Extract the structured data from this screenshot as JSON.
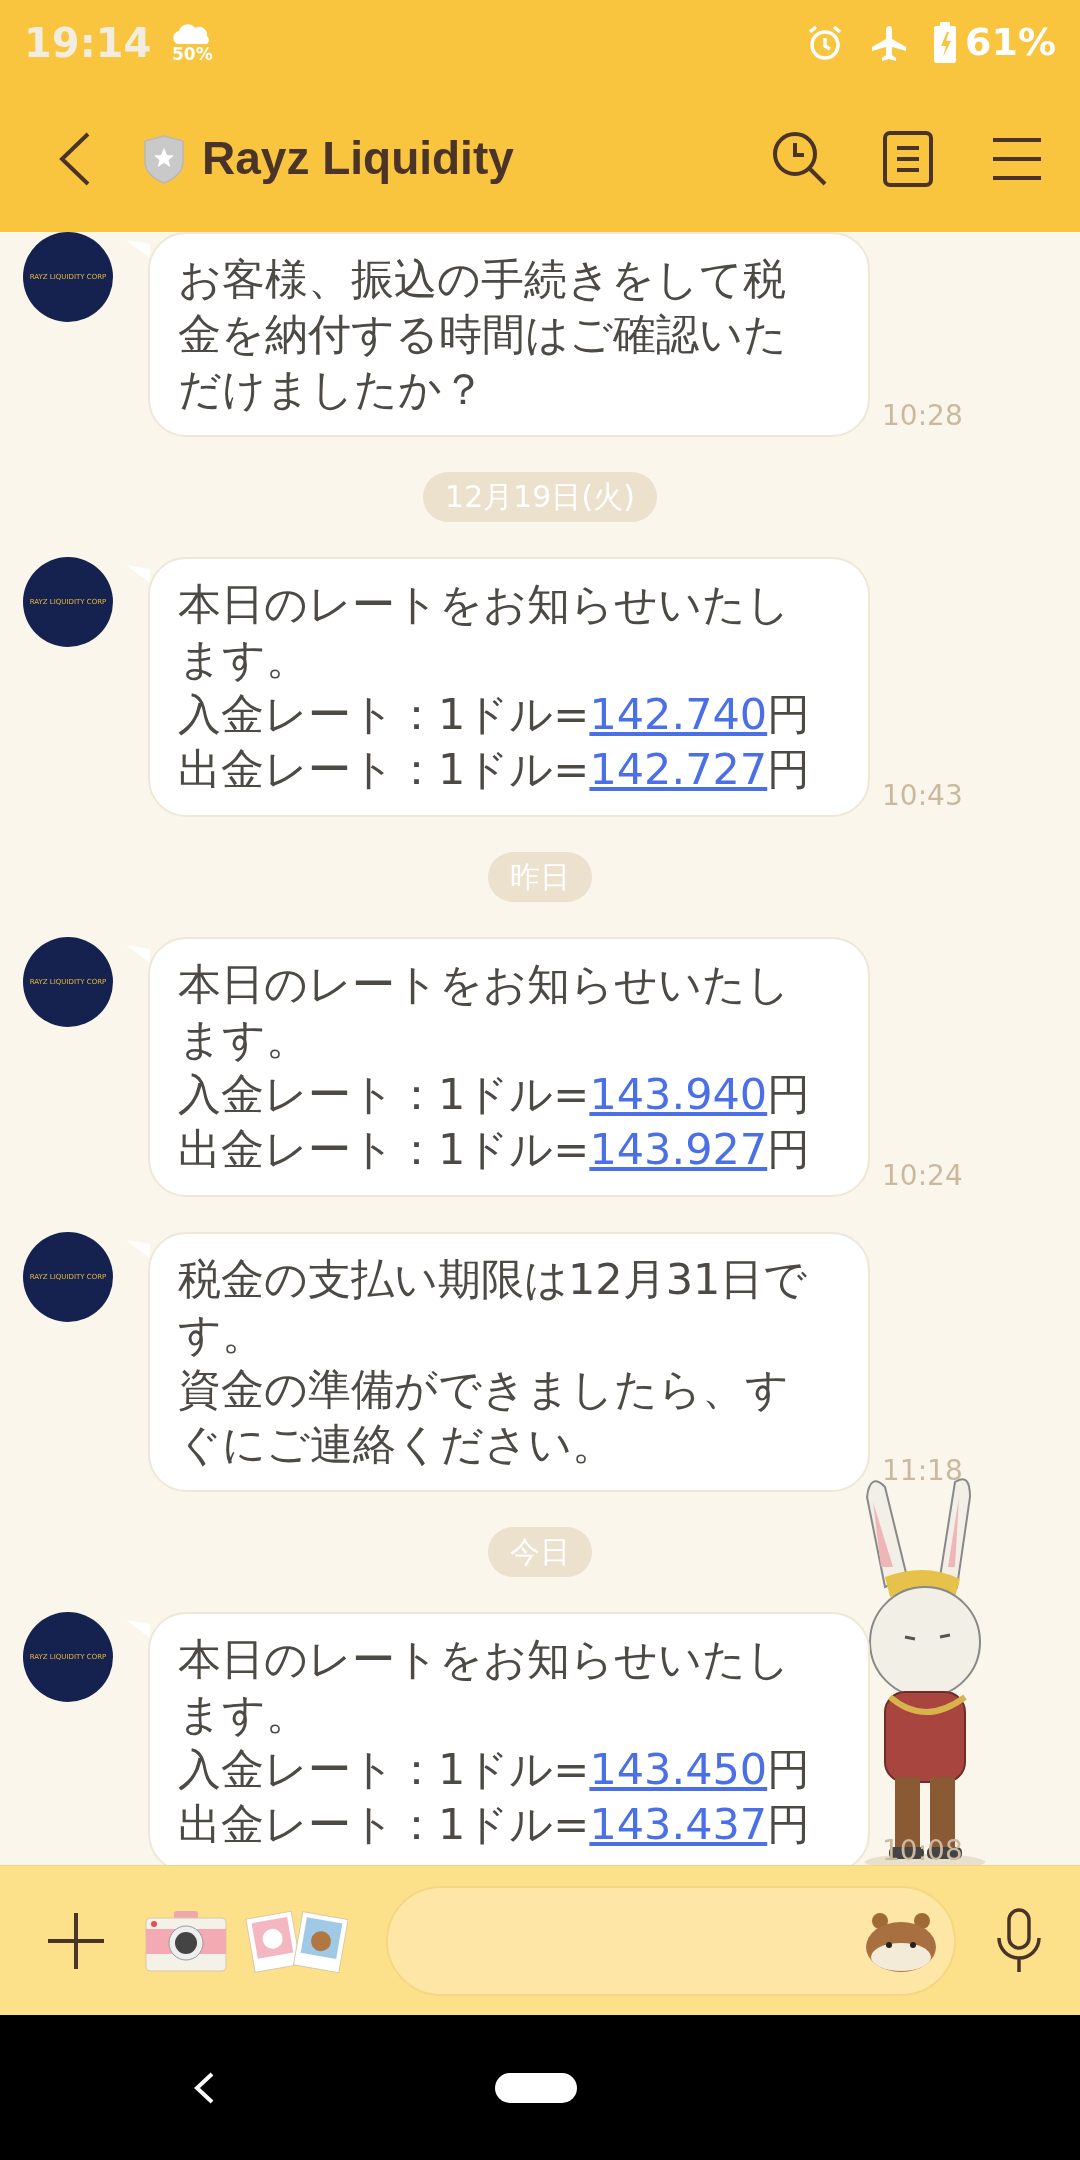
{
  "status_bar": {
    "time": "19:14",
    "weather": "50%",
    "battery": "61%"
  },
  "header": {
    "title": "Rayz Liquidity"
  },
  "chat": [
    {
      "kind": "message",
      "avatar_label": "RAYZ LIQUIDITY CORP",
      "text": "お客様、振込の手続きをして税金を納付する時間はご確認いただけましたか？",
      "time": "10:28"
    },
    {
      "kind": "date",
      "label": "12月19日(火)"
    },
    {
      "kind": "message",
      "avatar_label": "RAYZ LIQUIDITY CORP",
      "text": "本日のレートをお知らせいたします。",
      "rates": [
        {
          "label": "入金レート：1ドル=",
          "amount": "142.740",
          "unit": "円"
        },
        {
          "label": "出金レート：1ドル=",
          "amount": "142.727",
          "unit": "円"
        }
      ],
      "time": "10:43"
    },
    {
      "kind": "date",
      "label": "昨日"
    },
    {
      "kind": "message",
      "avatar_label": "RAYZ LIQUIDITY CORP",
      "text": "本日のレートをお知らせいたします。",
      "rates": [
        {
          "label": "入金レート：1ドル=",
          "amount": "143.940",
          "unit": "円"
        },
        {
          "label": "出金レート：1ドル=",
          "amount": "143.927",
          "unit": "円"
        }
      ],
      "time": "10:24"
    },
    {
      "kind": "message",
      "avatar_label": "RAYZ LIQUIDITY CORP",
      "text": "税金の支払い期限は12月31日です。",
      "more_text": "資金の準備ができましたら、すぐにご連絡ください。",
      "time": "11:18"
    },
    {
      "kind": "date",
      "label": "今日"
    },
    {
      "kind": "message",
      "avatar_label": "RAYZ LIQUIDITY CORP",
      "text": "本日のレートをお知らせいたします。",
      "rates": [
        {
          "label": "入金レート：1ドル=",
          "amount": "143.450",
          "unit": "円"
        },
        {
          "label": "出金レート：1ドル=",
          "amount": "143.437",
          "unit": "円"
        }
      ],
      "time": "10:08"
    }
  ]
}
